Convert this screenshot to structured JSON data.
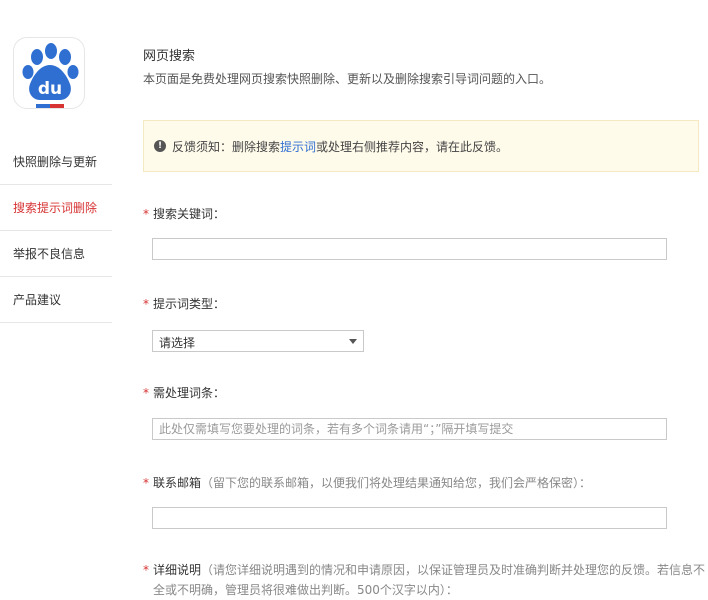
{
  "logo": {
    "name": "baidu-paw-logo",
    "text": "du"
  },
  "sidebar": {
    "items": [
      {
        "label": "快照删除与更新",
        "active": false
      },
      {
        "label": "搜索提示词删除",
        "active": true
      },
      {
        "label": "举报不良信息",
        "active": false
      },
      {
        "label": "产品建议",
        "active": false
      }
    ]
  },
  "header": {
    "title": "网页搜索",
    "description": "本页面是免费处理网页搜索快照删除、更新以及删除搜索引导词问题的入口。"
  },
  "notice": {
    "icon": "info-icon",
    "prefix": "反馈须知：删除搜索",
    "link": "提示词",
    "suffix": "或处理右侧推荐内容，请在此反馈。"
  },
  "form": {
    "required_mark": "*",
    "keyword": {
      "label": "搜索关键词：",
      "value": ""
    },
    "type": {
      "label": "提示词类型：",
      "selected": "请选择"
    },
    "terms": {
      "label": "需处理词条：",
      "placeholder": "此处仅需填写您要处理的词条，若有多个词条请用“；”隔开填写提交"
    },
    "email": {
      "label": "联系邮箱",
      "hint": "（留下您的联系邮箱，以便我们将处理结果通知给您，我们会严格保密）：",
      "value": ""
    },
    "details": {
      "label": "详细说明",
      "hint_line1": "（请您详细说明遇到的情况和申请原因，以保证管理员及时准确判断并处理您的反馈。若信息不",
      "hint_line2": "全或不明确，管理员将很难做出判断。500个汉字以内）："
    }
  },
  "colors": {
    "accent_red": "#d73333",
    "link_blue": "#2f6fd1",
    "notice_bg": "#fffbeb"
  }
}
